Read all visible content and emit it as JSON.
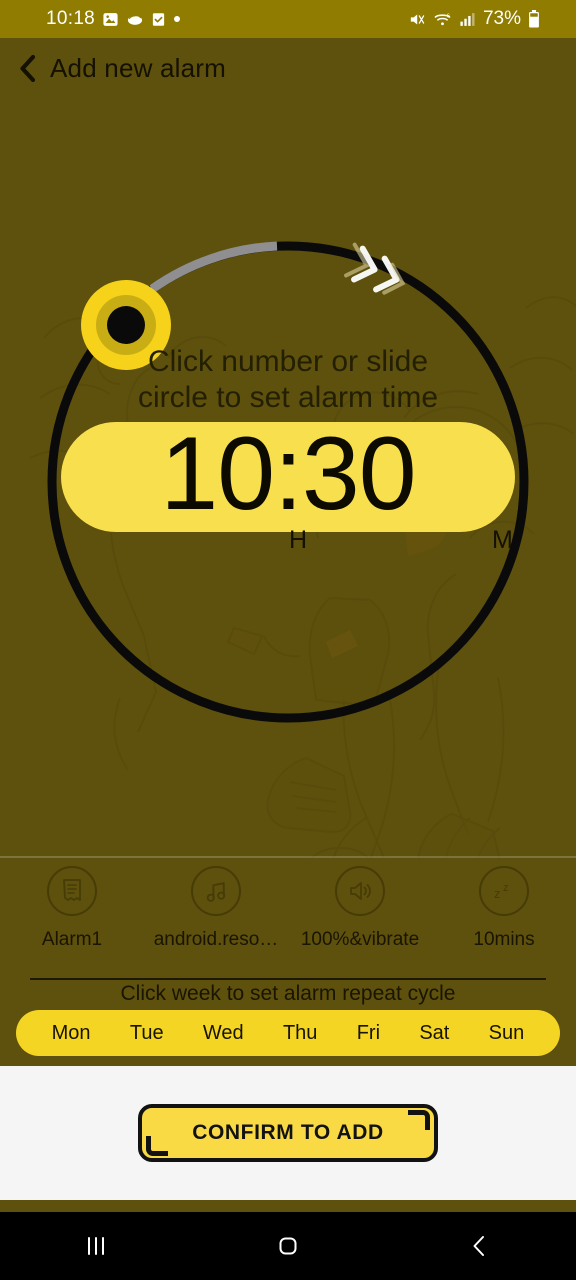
{
  "status_bar": {
    "time": "10:18",
    "battery_percent": "73%",
    "left_icons": [
      "image-icon",
      "cloud-icon",
      "checkbox-icon",
      "dot-icon"
    ],
    "right_icons": [
      "mute-icon",
      "wifi-icon",
      "signal-icon",
      "battery-icon"
    ],
    "background": "#8f7c01"
  },
  "header": {
    "back_icon": "back-chevron-icon",
    "title": "Add new alarm"
  },
  "dial": {
    "hint_line1": "Click number or slide",
    "hint_line2": "circle to set alarm time",
    "time": "10:30",
    "hour_label": "H",
    "minute_label": "M",
    "track_color": "#0a0a0a",
    "progress_color": "#8f8f92",
    "knob_color": "#f7d21a",
    "knob_center_color": "#0a0a0a",
    "arrow_icon": "double-chevron-clockwise-icon",
    "pill_color": "#f7df4e"
  },
  "options": [
    {
      "icon": "note-icon",
      "label": "Alarm1"
    },
    {
      "icon": "music-icon",
      "label": "android.reso…"
    },
    {
      "icon": "volume-icon",
      "label": "100%&vibrate"
    },
    {
      "icon": "snooze-icon",
      "label": "10mins"
    }
  ],
  "week": {
    "hint": "Click week to set alarm repeat cycle",
    "days": [
      "Mon",
      "Tue",
      "Wed",
      "Thu",
      "Fri",
      "Sat",
      "Sun"
    ],
    "pill_color": "#f5d523"
  },
  "bottom": {
    "confirm_label": "CONFIRM TO ADD",
    "panel_color": "#f5f5f5",
    "button_color": "#fada44"
  },
  "nav_bar": {
    "recents_icon": "recents-icon",
    "home_icon": "home-icon",
    "back_icon": "back-icon"
  },
  "theme": {
    "background": "#5e500d",
    "accent": "#f7df4e",
    "text_dark": "#141100"
  }
}
